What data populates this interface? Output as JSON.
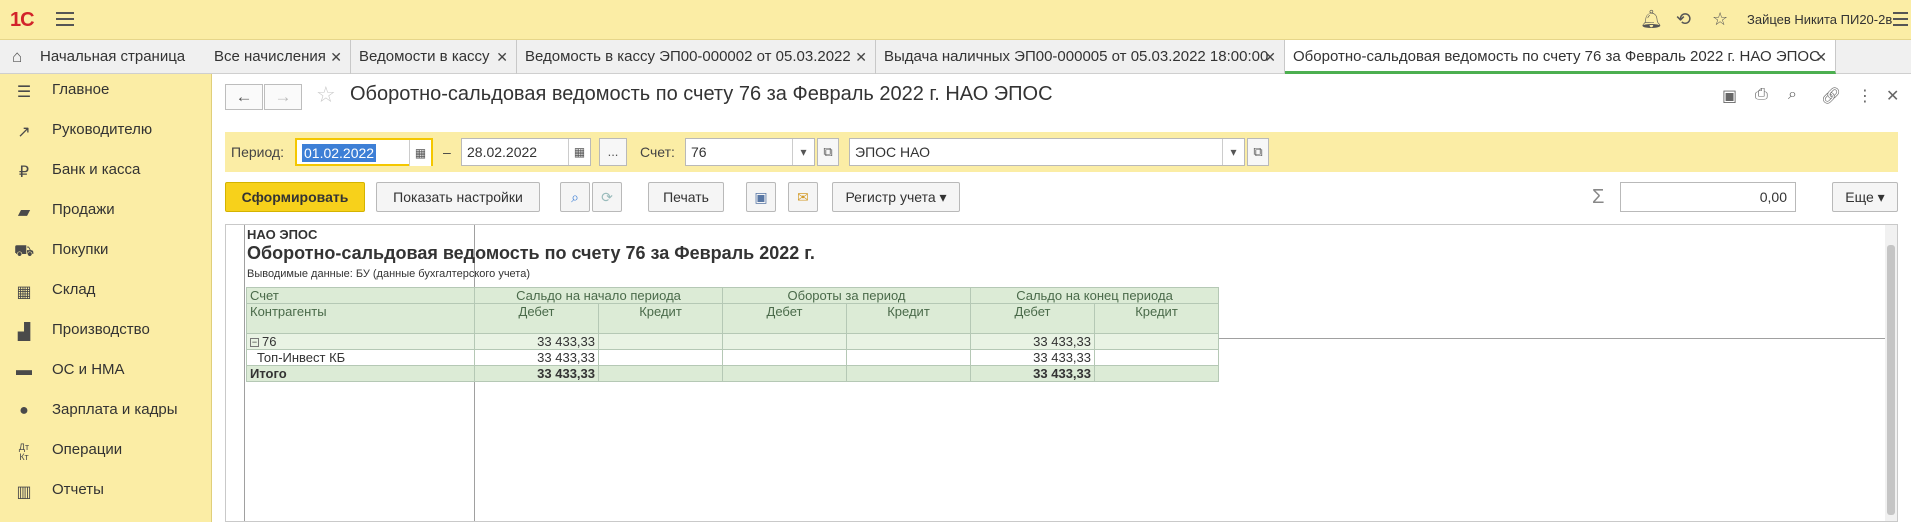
{
  "app": {
    "logo": "1С",
    "user": "Зайцев Никита ПИ20-2в"
  },
  "tabs": [
    {
      "label": "Начальная страница"
    },
    {
      "label": "Все начисления"
    },
    {
      "label": "Ведомости в кассу"
    },
    {
      "label": "Ведомость в кассу ЭП00-000002 от 05.03.2022"
    },
    {
      "label": "Выдача наличных ЭП00-000005 от 05.03.2022 18:00:00"
    },
    {
      "label": "Оборотно-сальдовая ведомость по счету 76 за Февраль 2022 г. НАО ЭПОС"
    }
  ],
  "sidebar": {
    "items": [
      {
        "label": "Главное",
        "icon": "menu-icon"
      },
      {
        "label": "Руководителю",
        "icon": "trend-icon"
      },
      {
        "label": "Банк и касса",
        "icon": "ruble-icon"
      },
      {
        "label": "Продажи",
        "icon": "bag-icon"
      },
      {
        "label": "Покупки",
        "icon": "cart-icon"
      },
      {
        "label": "Склад",
        "icon": "warehouse-icon"
      },
      {
        "label": "Производство",
        "icon": "factory-icon"
      },
      {
        "label": "ОС и НМА",
        "icon": "truck-icon"
      },
      {
        "label": "Зарплата и кадры",
        "icon": "person-icon"
      },
      {
        "label": "Операции",
        "icon": "dt-kt-icon"
      },
      {
        "label": "Отчеты",
        "icon": "bar-chart-icon"
      }
    ]
  },
  "document": {
    "title": "Оборотно-сальдовая ведомость по счету 76 за Февраль 2022 г. НАО ЭПОС"
  },
  "params": {
    "period_label": "Период:",
    "date_from": "01.02.2022",
    "dash": "–",
    "date_to": "28.02.2022",
    "ellipsis": "...",
    "account_label": "Счет:",
    "account": "76",
    "organization": "ЭПОС НАО"
  },
  "toolbar": {
    "generate": "Сформировать",
    "show_settings": "Показать настройки",
    "print": "Печать",
    "register": "Регистр учета",
    "sum_value": "0,00",
    "more": "Еще"
  },
  "report": {
    "org": "НАО ЭПОС",
    "title": "Оборотно-сальдовая ведомость по счету 76 за Февраль 2022 г.",
    "subtitle": "Выводимые данные:   БУ (данные бухгалтерского учета)",
    "headers": {
      "account": "Счет",
      "counterparties": "Контрагенты",
      "opening": "Сальдо на начало периода",
      "turnover": "Обороты за период",
      "closing": "Сальдо на конец периода",
      "debit": "Дебет",
      "credit": "Кредит"
    },
    "rows": [
      {
        "name": "76",
        "open_debit": "33 433,33",
        "open_credit": "",
        "turn_debit": "",
        "turn_credit": "",
        "close_debit": "33 433,33",
        "close_credit": ""
      },
      {
        "name": "Топ-Инвест КБ",
        "open_debit": "33 433,33",
        "open_credit": "",
        "turn_debit": "",
        "turn_credit": "",
        "close_debit": "33 433,33",
        "close_credit": ""
      },
      {
        "name": "Итого",
        "open_debit": "33 433,33",
        "open_credit": "",
        "turn_debit": "",
        "turn_credit": "",
        "close_debit": "33 433,33",
        "close_credit": ""
      }
    ]
  }
}
